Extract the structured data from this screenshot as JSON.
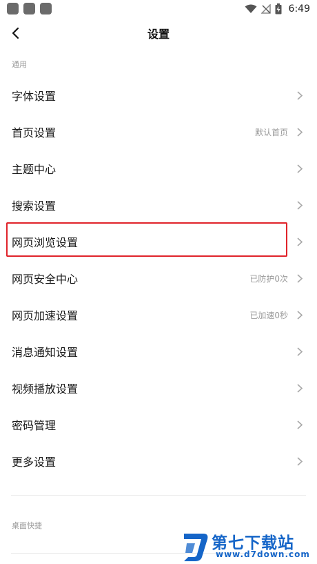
{
  "status_bar": {
    "time": "6:49"
  },
  "header": {
    "title": "设置"
  },
  "sections": {
    "general": "通用",
    "desktop_shortcuts": "桌面快捷"
  },
  "settings": [
    {
      "label": "字体设置",
      "value": ""
    },
    {
      "label": "首页设置",
      "value": "默认首页"
    },
    {
      "label": "主题中心",
      "value": ""
    },
    {
      "label": "搜索设置",
      "value": ""
    },
    {
      "label": "网页浏览设置",
      "value": ""
    },
    {
      "label": "网页安全中心",
      "value": "已防护0次"
    },
    {
      "label": "网页加速设置",
      "value": "已加速0秒"
    },
    {
      "label": "消息通知设置",
      "value": ""
    },
    {
      "label": "视频播放设置",
      "value": ""
    },
    {
      "label": "密码管理",
      "value": ""
    },
    {
      "label": "更多设置",
      "value": ""
    }
  ],
  "highlight_color": "#e0232a",
  "watermark": {
    "text": "第七下载站",
    "url": "www.d7down.com",
    "color": "#1565c8"
  }
}
